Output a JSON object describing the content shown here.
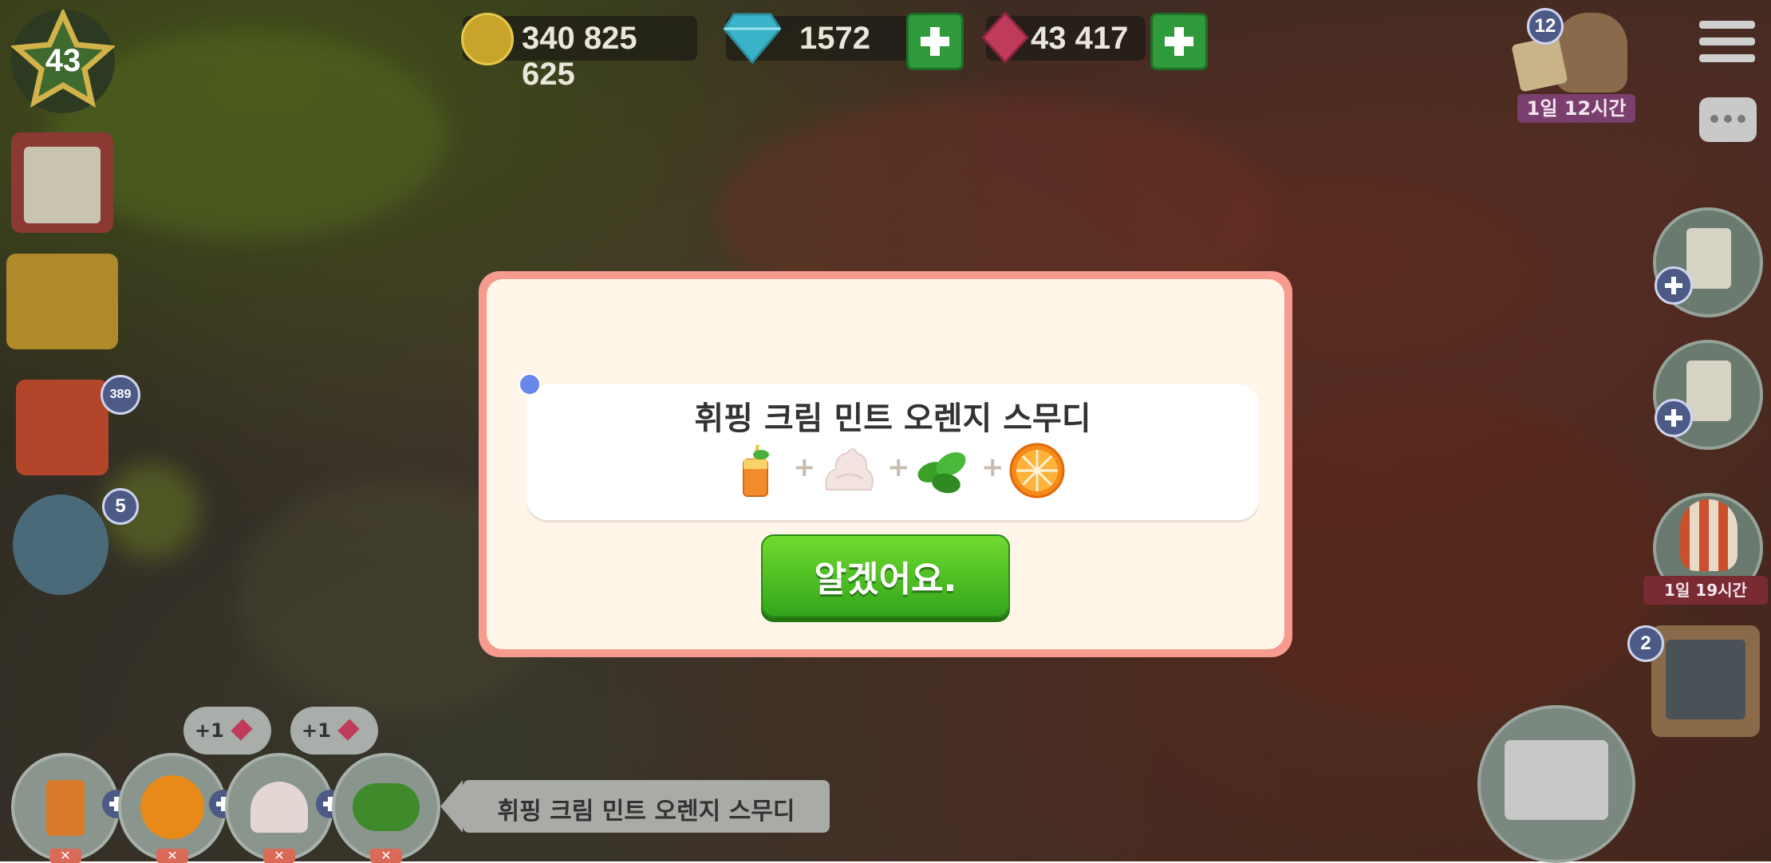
{
  "header": {
    "level": "43",
    "coins": "340 825 625",
    "diamonds": "1572",
    "gems": "43 417"
  },
  "event": {
    "badge": "12",
    "timer": "1일 12시간"
  },
  "left_sidebar": {
    "gift_badge": "389",
    "cube_badge": "5"
  },
  "right_sidebar": {
    "balloon_timer": "1일 19시간",
    "board_badge": "2"
  },
  "modal": {
    "recipe_title": "휘핑 크림 민트 오렌지 스무디",
    "ingredients": [
      "smoothie-glass-icon",
      "whipped-cream-icon",
      "mint-leaves-icon",
      "orange-slice-icon"
    ],
    "ok_label": "알겠어요."
  },
  "bottom_bar": {
    "bonus_1": "+1",
    "bonus_2": "+1",
    "recipe_name": "휘핑 크림 민트 오렌지 스무디"
  },
  "colors": {
    "modal_border": "#f79b8f",
    "modal_bg": "#fff5e8",
    "ok_button": "#34a51c",
    "accent_plus": "#2e9a3a"
  }
}
